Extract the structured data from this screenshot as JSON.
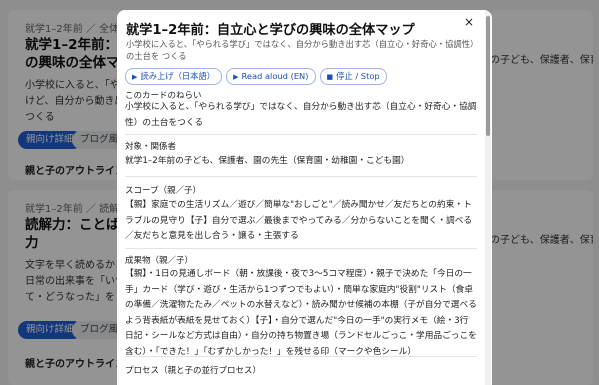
{
  "background": {
    "card1": {
      "crumb": "就学1–2年前 ／ 全体マップ ／",
      "title_line1": "就学1–2年前：自立心",
      "title_line2": "の興味の全体マップ",
      "desc_line1": "小学校に入ると、「やられる",
      "desc_line2": "けど、自分から動き出す",
      "desc_line3": "つくる",
      "primary_button": "親向け詳細",
      "secondary_button": "ブログ風に",
      "section": "親と子のアウトライン（ざっく"
    },
    "card2": {
      "crumb": "就学1–2年前 ／ 読解力 ／",
      "title_line1": "読解力：ことばと物語で",
      "title_line2": "力",
      "desc_line1": "文字を早く読めるかどうかではな",
      "desc_line2": "日常の出来事を「いつ・どこで・誰",
      "desc_line3": "て・どうなった」を",
      "primary_button": "親向け詳細",
      "secondary_button": "ブログ風に要",
      "section": "親と子のアウトライン（ざっくり"
    },
    "right1": {
      "line1": "の子ども、保護者、保育者",
      "line2": ""
    },
    "right2": {
      "line1": "の子ども、保護者、保育者",
      "line2": ""
    }
  },
  "modal": {
    "title": "就学1–2年前：自立心と学びの興味の全体マップ",
    "subtitle": "小学校に入ると、「やられる学び」ではなく、自分から動き出す芯（自立心・好奇心・協調性）の土台を つくる",
    "close": "×",
    "audio_buttons": [
      {
        "icon": "▶",
        "label": "読み上げ（日本語）"
      },
      {
        "icon": "▶",
        "label": "Read aloud (EN)"
      },
      {
        "icon": "■",
        "label": "停止 / Stop"
      }
    ],
    "sections": [
      {
        "heading": "このカードのねらい",
        "body": "小学校に入ると、「やられる学び」ではなく、自分から動き出す芯（自立心・好奇心・協調性）の土台をつくる"
      },
      {
        "heading": "対象・関係者",
        "body": "就学1–2年前の子ども、保護者、園の先生（保育園・幼稚園・こども園）"
      },
      {
        "heading": "スコープ（親／子）",
        "body": "【親】家庭での生活リズム／遊び／簡単な\"おしごと\"／読み聞かせ／友だちとの約束・トラブルの見守り【子】自分で選ぶ／最後までやってみる／分からないことを聞く・調べる／友だちと意見を出し合う・譲る・主張する"
      },
      {
        "heading": "成果物（親／子）",
        "body": "【親】・1日の見通しボード（朝・放課後・夜で3〜5コマ程度）・親子で決めた「今日の一手」カード（学び・遊び・生活から1つずつでもよい）・簡単な家庭内\"役割\"リスト（食卓の準備／洗濯物たたみ／ペットの水替えなど）・読み聞かせ候補の本棚（子が自分で選べるよう背表紙が表紙を見せておく）【子】・自分で選んだ\"今日の一手\"の実行メモ（絵・3行日記・シールなど方式は自由）・自分の持ち物置き場（ランドセルごっこ・学用品ごっこを含む）・「できた！」「むずかしかった！」を残せる印（マークや色シール）"
      },
      {
        "heading": "プロセス（親と子の並行プロセス）",
        "body": ""
      }
    ]
  }
}
